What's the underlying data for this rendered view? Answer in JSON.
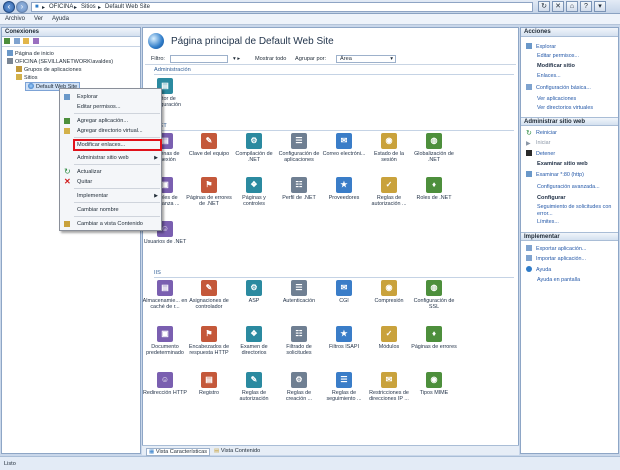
{
  "address": {
    "parts": [
      "OFICINA",
      "Sitios",
      "Default Web Site"
    ]
  },
  "menu": [
    "Archivo",
    "Ver",
    "Ayuda"
  ],
  "connections": {
    "title": "Conexiones",
    "tree": [
      "Página de inicio",
      "OFICINA (SEVILLANETWORK\\avaldes)",
      "Grupos de aplicaciones",
      "Sitios",
      "Default Web Site"
    ]
  },
  "context_menu": [
    "Explorar",
    "Editar permisos...",
    "Agregar aplicación...",
    "Agregar directorio virtual...",
    "Modificar enlaces...",
    "Administrar sitio web",
    "Actualizar",
    "Quitar",
    "Implementar",
    "Cambiar nombre",
    "Cambiar a vista Contenido"
  ],
  "page": {
    "title": "Página principal de Default Web Site",
    "filter_label": "Filtro:",
    "show_all": "Mostrar todo",
    "group_label": "Agrupar por:",
    "group_value": "Área"
  },
  "sections": {
    "admin": "Administración",
    "net": ".NET",
    "iis": "IIS"
  },
  "features": {
    "admin": [
      "Editor de configuración"
    ],
    "net": [
      "Cadenas de conexión",
      "Clave del equipo",
      "Compilación de .NET",
      "Configuración de aplicaciones",
      "Correo electróni...",
      "Estado de la sesión",
      "Globalización de .NET",
      "Niveles de confianza ...",
      "Páginas de errores de .NET",
      "Páginas y controles",
      "Perfil de .NET",
      "Proveedores",
      "Reglas de autorización ...",
      "Roles de .NET",
      "Usuarios de .NET"
    ],
    "iis": [
      "Almacenamie... en caché de r...",
      "Asignaciones de controlador",
      "ASP",
      "Autenticación",
      "CGI",
      "Compresión",
      "Configuración de SSL",
      "Documento predeterminado",
      "Encabezados de respuesta HTTP",
      "Examen de directorios",
      "Filtrado de solicitudes",
      "Filtros ISAPI",
      "Módulos",
      "Páginas de errores",
      "Redirección HTTP",
      "Registro",
      "Reglas de autorización",
      "Reglas de creación ...",
      "Reglas de seguimiento ...",
      "Restricciones de direcciones IP ...",
      "Tipos MIME"
    ]
  },
  "tabs": [
    "Vista Características",
    "Vista Contenido"
  ],
  "actions": {
    "title": "Acciones",
    "top": [
      "Explorar",
      "Editar permisos..."
    ],
    "modify_heading": "Modificar sitio",
    "modify": [
      "Enlaces...",
      "Configuración básica...",
      "Ver aplicaciones",
      "Ver directorios virtuales"
    ],
    "manage_section": "Administrar sitio web",
    "manage": [
      "Reiniciar",
      "Iniciar",
      "Detener"
    ],
    "browse_heading": "Examinar sitio web",
    "browse": [
      "Examinar *:80 (http)",
      "Configuración avanzada..."
    ],
    "configure_heading": "Configurar",
    "configure": [
      "Seguimiento de solicitudes con error...",
      "Límites..."
    ],
    "deploy_section": "Implementar",
    "deploy": [
      "Exportar aplicación...",
      "Importar aplicación...",
      "Ayuda",
      "Ayuda en pantalla"
    ]
  },
  "status": "Listo"
}
